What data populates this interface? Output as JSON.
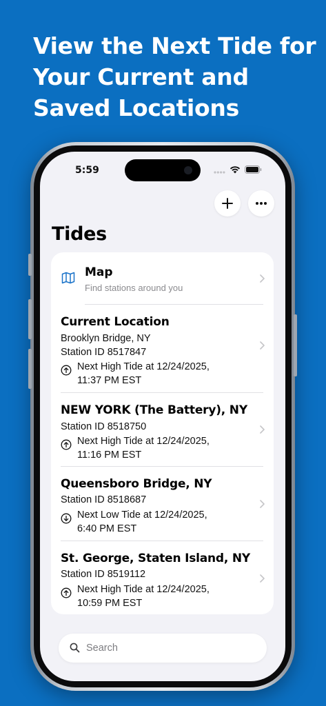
{
  "headline": {
    "line1": "View the Next Tide for",
    "line2": "Your Current and",
    "line3": "Saved Locations"
  },
  "status_bar": {
    "time": "5:59"
  },
  "toolbar": {
    "add_icon": "plus-icon",
    "more_icon": "ellipsis-icon"
  },
  "page_title": "Tides",
  "map_row": {
    "icon": "map-icon",
    "title": "Map",
    "subtitle": "Find stations around you"
  },
  "locations": [
    {
      "name": "Current Location",
      "detail": "Brooklyn Bridge, NY",
      "station": "Station ID 8517847",
      "tide_direction": "up",
      "tide_line1": "Next High Tide at 12/24/2025,",
      "tide_line2": "11:37 PM EST"
    },
    {
      "name": "NEW YORK (The Battery), NY",
      "station": "Station ID 8518750",
      "tide_direction": "up",
      "tide_line1": "Next High Tide at 12/24/2025,",
      "tide_line2": "11:16 PM EST"
    },
    {
      "name": "Queensboro Bridge, NY",
      "station": "Station ID 8518687",
      "tide_direction": "down",
      "tide_line1": "Next Low Tide at 12/24/2025,",
      "tide_line2": "6:40 PM EST"
    },
    {
      "name": "St. George, Staten Island, NY",
      "station": "Station ID 8519112",
      "tide_direction": "up",
      "tide_line1": "Next High Tide at 12/24/2025,",
      "tide_line2": "10:59 PM EST"
    }
  ],
  "search": {
    "placeholder": "Search"
  },
  "colors": {
    "background": "#0b6fc1",
    "accent": "#1a73c9",
    "screen_background": "#f2f2f7"
  }
}
